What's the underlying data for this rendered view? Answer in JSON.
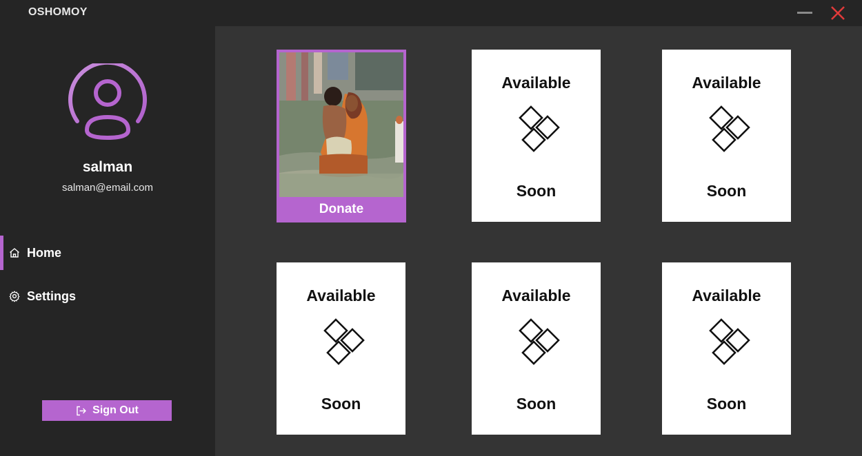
{
  "window": {
    "title": "OSHOMOY",
    "close_color": "#e03a3a"
  },
  "theme": {
    "accent": "#b565cf",
    "sidebar_bg": "#252525",
    "main_bg": "#343434"
  },
  "user": {
    "name": "salman",
    "email": "salman@email.com"
  },
  "nav": {
    "items": [
      {
        "label": "Home",
        "icon": "home-icon",
        "active": true
      },
      {
        "label": "Settings",
        "icon": "gear-icon",
        "active": false
      }
    ]
  },
  "signout": {
    "label": "Sign Out",
    "icon": "logout-icon"
  },
  "cards": [
    {
      "type": "donate",
      "label": "Donate",
      "image": "flood-relief-photo"
    },
    {
      "type": "placeholder",
      "top": "Available",
      "bottom": "Soon",
      "icon": "diamond-tiles-icon"
    },
    {
      "type": "placeholder",
      "top": "Available",
      "bottom": "Soon",
      "icon": "diamond-tiles-icon"
    },
    {
      "type": "placeholder",
      "top": "Available",
      "bottom": "Soon",
      "icon": "diamond-tiles-icon"
    },
    {
      "type": "placeholder",
      "top": "Available",
      "bottom": "Soon",
      "icon": "diamond-tiles-icon"
    },
    {
      "type": "placeholder",
      "top": "Available",
      "bottom": "Soon",
      "icon": "diamond-tiles-icon"
    }
  ]
}
